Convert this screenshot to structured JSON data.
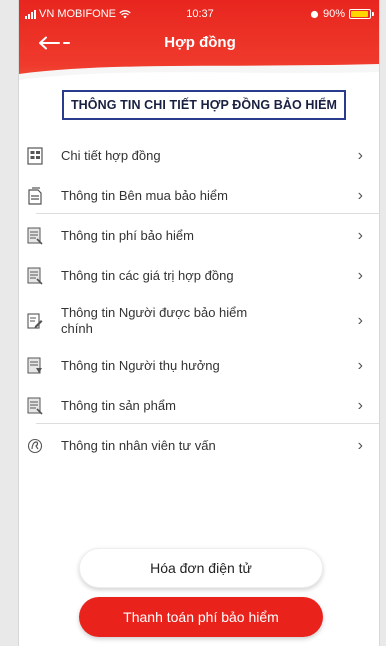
{
  "status_bar": {
    "carrier": "VN MOBIFONE",
    "time": "10:37",
    "battery": "90%"
  },
  "header": {
    "title": "Hợp đồng",
    "back_icon": "arrow-left-icon",
    "background_color": "#e8261f"
  },
  "section_title": "THÔNG TIN CHI TIẾT HỢP ĐỒNG BẢO HIỂM",
  "menu": {
    "items": [
      {
        "label": "Chi tiết hợp đồng",
        "icon": "contract-grid-icon"
      },
      {
        "label": "Thông tin Bên mua bảo hiểm",
        "icon": "buyer-document-icon"
      },
      {
        "label": "Thông tin phí bảo hiểm",
        "icon": "fee-document-icon"
      },
      {
        "label": "Thông tin các giá trị hợp đồng",
        "icon": "value-document-icon"
      },
      {
        "label": "Thông tin Người được bảo hiểm chính",
        "icon": "insured-edit-icon"
      },
      {
        "label": "Thông tin Người thụ hưởng",
        "icon": "beneficiary-document-icon"
      },
      {
        "label": "Thông tin sản phẩm",
        "icon": "product-document-icon"
      },
      {
        "label": "Thông tin nhân viên tư vấn",
        "icon": "advisor-hand-icon"
      }
    ],
    "chevron": "›"
  },
  "buttons": {
    "invoice": "Hóa đơn điện tử",
    "pay": "Thanh toán phí bảo hiểm",
    "accent_color": "#e9231c"
  }
}
